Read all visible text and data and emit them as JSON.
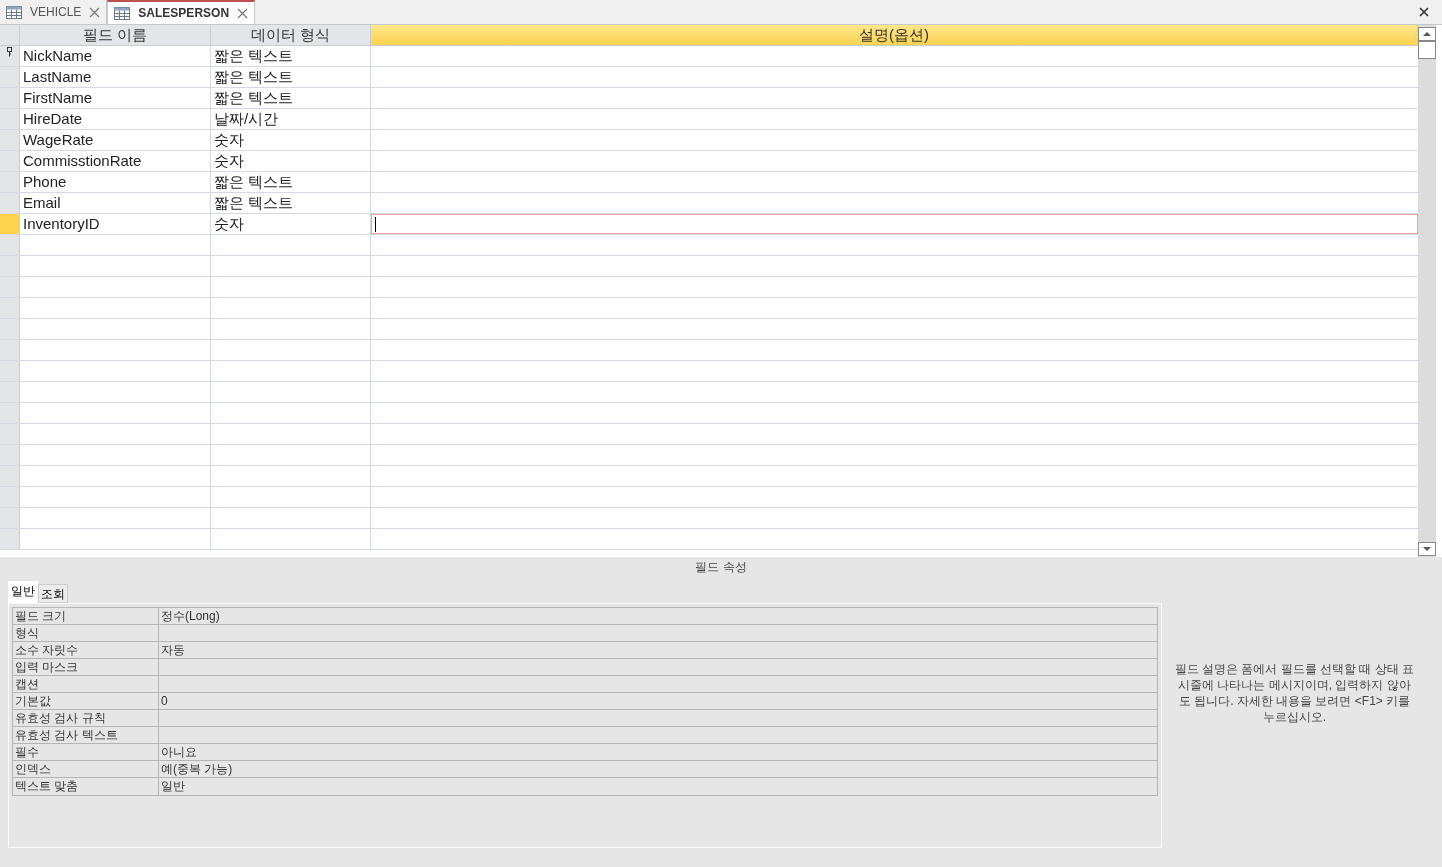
{
  "tabs": [
    {
      "label": "VEHICLE",
      "selected": false
    },
    {
      "label": "SALESPERSON",
      "selected": true
    }
  ],
  "grid": {
    "columns": [
      "필드 이름",
      "데이터 형식",
      "설명(옵션)"
    ],
    "rows": [
      {
        "name": "NickName",
        "type": "짧은 텍스트",
        "primary_key": true,
        "selected": false
      },
      {
        "name": "LastName",
        "type": "짧은 텍스트",
        "primary_key": false,
        "selected": false
      },
      {
        "name": "FirstName",
        "type": "짧은 텍스트",
        "primary_key": false,
        "selected": false
      },
      {
        "name": "HireDate",
        "type": "날짜/시간",
        "primary_key": false,
        "selected": false
      },
      {
        "name": "WageRate",
        "type": "숫자",
        "primary_key": false,
        "selected": false
      },
      {
        "name": "CommisstionRate",
        "type": "숫자",
        "primary_key": false,
        "selected": false
      },
      {
        "name": "Phone",
        "type": "짧은 텍스트",
        "primary_key": false,
        "selected": false
      },
      {
        "name": "Email",
        "type": "짧은 텍스트",
        "primary_key": false,
        "selected": false
      },
      {
        "name": "InventoryID",
        "type": "숫자",
        "primary_key": false,
        "selected": true
      }
    ]
  },
  "field_properties": {
    "title": "필드 속성",
    "tabs": [
      {
        "label": "일반",
        "selected": true
      },
      {
        "label": "조회",
        "selected": false
      }
    ],
    "rows": [
      {
        "label": "필드 크기",
        "value": "정수(Long)"
      },
      {
        "label": "형식"
      },
      {
        "label": "소수 자릿수",
        "value": "자동"
      },
      {
        "label": "입력 마스크"
      },
      {
        "label": "캡션"
      },
      {
        "label": "기본값",
        "value": "0"
      },
      {
        "label": "유효성 검사 규칙"
      },
      {
        "label": "유효성 검사 텍스트"
      },
      {
        "label": "필수",
        "value": "아니요"
      },
      {
        "label": "인덱스",
        "value": "예(중복 가능)"
      },
      {
        "label": "텍스트 맞춤",
        "value": "일반"
      }
    ],
    "help": "필드 설명은 폼에서 필드를 선택할 때 상태 표시줄에 나타나는 메시지이며, 입력하지 않아도 됩니다. 자세한 내용을 보려면 <F1> 키를 누르십시오."
  }
}
